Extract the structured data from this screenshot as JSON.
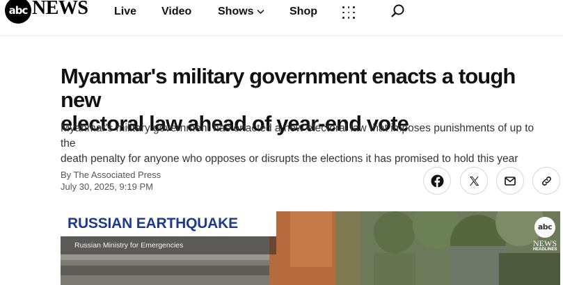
{
  "header": {
    "logo_abc": "abc",
    "logo_news": "NEWS",
    "nav": {
      "live": "Live",
      "video": "Video",
      "shows": "Shows",
      "shop": "Shop"
    },
    "icons": [
      "grid-menu-icon",
      "search-icon",
      "chevron-down-icon"
    ]
  },
  "article": {
    "headline_line1": "Myanmar's military government enacts a tough new",
    "headline_line2": "electoral law ahead of year-end vote",
    "subhead_line1": "Myanmar's military government has enacted a new electoral law that imposes punishments of up to the",
    "subhead_line2": "death penalty for anyone who opposes or disrupts the elections it has promised to hold this year",
    "byline": "By The Associated Press",
    "timestamp": "July 30, 2025, 9:19 PM"
  },
  "share": {
    "icons": [
      "facebook-icon",
      "x-icon",
      "mail-icon",
      "link-icon"
    ]
  },
  "video": {
    "lower_third_title": "RUSSIAN EARTHQUAKE",
    "lower_third_source": "Russian Ministry for Emergencies",
    "watermark_abc": "abc",
    "watermark_news": "NEWS",
    "watermark_sub": "HEADLINES"
  },
  "colors": {
    "lower_third_text": "#1f3a8c",
    "text_primary": "#111111",
    "text_secondary": "#555555"
  }
}
